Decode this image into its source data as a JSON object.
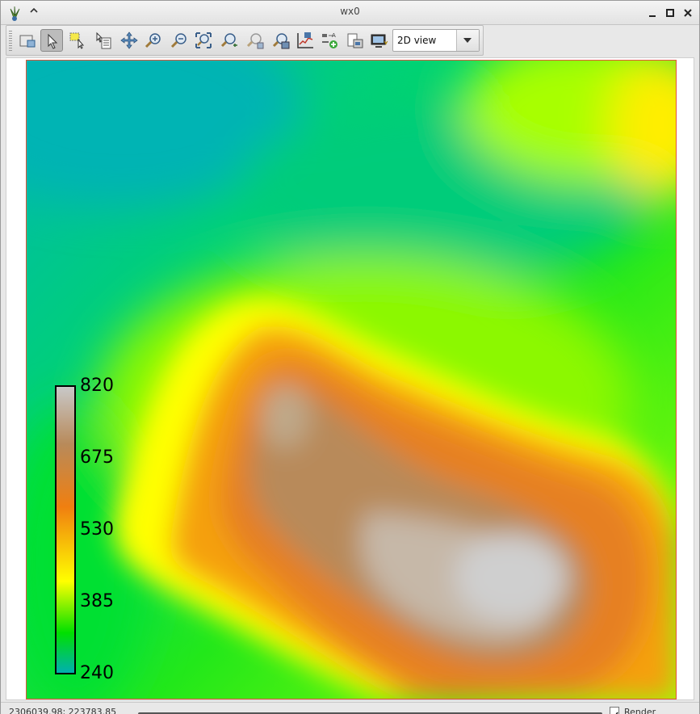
{
  "window": {
    "title": "wx0"
  },
  "toolbar": {
    "buttons": [
      {
        "name": "display-map-icon"
      },
      {
        "name": "pointer-icon",
        "active": true
      },
      {
        "name": "select-features-icon"
      },
      {
        "name": "query-icon"
      },
      {
        "name": "pan-icon"
      },
      {
        "name": "zoom-in-icon"
      },
      {
        "name": "zoom-out-icon"
      },
      {
        "name": "zoom-extent-icon"
      },
      {
        "name": "zoom-back-icon"
      },
      {
        "name": "zoom-forward-icon"
      },
      {
        "name": "zoom-menu-icon"
      },
      {
        "name": "analyze-icon"
      },
      {
        "name": "add-decoration-icon"
      },
      {
        "name": "map-display-icon"
      },
      {
        "name": "save-display-icon"
      }
    ],
    "view_mode": "2D view"
  },
  "legend": {
    "labels": [
      "820",
      "675",
      "530",
      "385",
      "240"
    ],
    "colors": [
      "#c8c8c8",
      "#b88a5a",
      "#f07f10",
      "#ffff00",
      "#00e000",
      "#00b0b0"
    ]
  },
  "statusbar": {
    "coordinates": "2306039.98; 223783.85",
    "render_label": "Render",
    "render_checked": true
  }
}
